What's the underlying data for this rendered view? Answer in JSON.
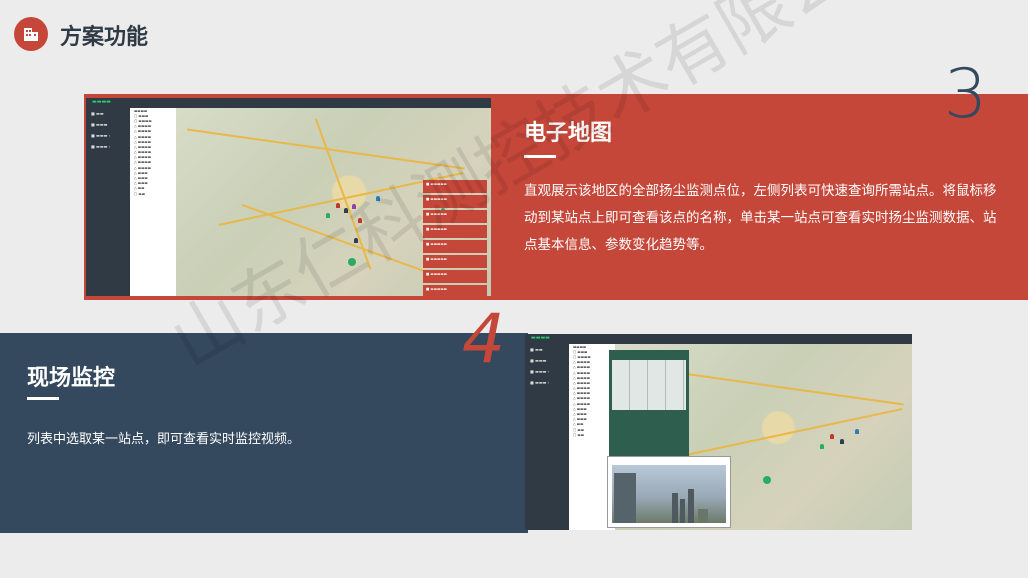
{
  "header": {
    "title": "方案功能",
    "icon": "building-icon",
    "accent": "#c5473a"
  },
  "section3": {
    "number": "3",
    "title": "电子地图",
    "description": "直观展示该地区的全部扬尘监测点位，左侧列表可快速查询所需站点。将鼠标移动到某站点上即可查看该点的名称，单击某一站点可查看实时扬尘监测数据、站点基本信息、参数变化趋势等。"
  },
  "section4": {
    "number": "4",
    "title": "现场监控",
    "description": "列表中选取某一站点，即可查看实时监控视频。"
  },
  "watermark": "山东仁科测控技术有限公司",
  "colors": {
    "red": "#c5473a",
    "navy": "#34495e",
    "background": "#ececec"
  }
}
